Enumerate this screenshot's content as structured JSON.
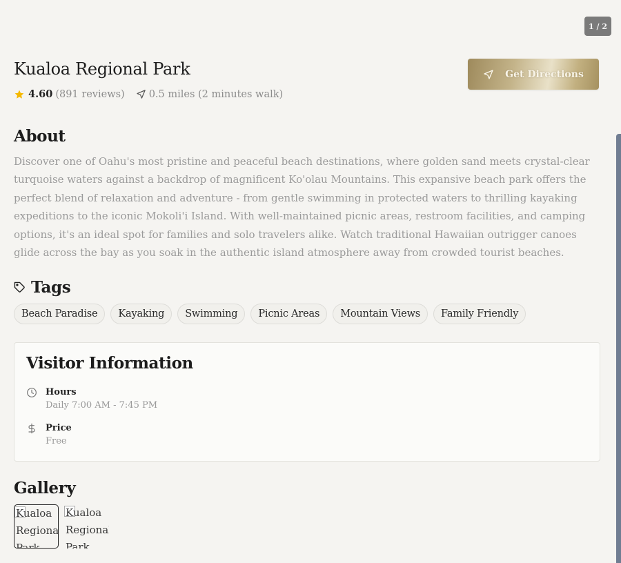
{
  "page_counter": "1 / 2",
  "place": {
    "name": "Kualoa Regional Park",
    "rating": "4.60",
    "reviews": "(891 reviews)",
    "distance": "0.5 miles (2 minutes walk)"
  },
  "actions": {
    "directions_label": "Get Directions"
  },
  "about": {
    "heading": "About",
    "text": "Discover one of Oahu's most pristine and peaceful beach destinations, where golden sand meets crystal-clear turquoise waters against a backdrop of magnificent Ko'olau Mountains. This expansive beach park offers the perfect blend of relaxation and adventure - from gentle swimming in protected waters to thrilling kayaking expeditions to the iconic Mokoli'i Island. With well-maintained picnic areas, restroom facilities, and camping options, it's an ideal spot for families and solo travelers alike. Watch traditional Hawaiian outrigger canoes glide across the bay as you soak in the authentic island atmosphere away from crowded tourist beaches."
  },
  "tags": {
    "heading": "Tags",
    "items": [
      "Beach Paradise",
      "Kayaking",
      "Swimming",
      "Picnic Areas",
      "Mountain Views",
      "Family Friendly"
    ]
  },
  "visitor_info": {
    "heading": "Visitor Information",
    "hours_label": "Hours",
    "hours_value": "Daily 7:00 AM - 7:45 PM",
    "price_label": "Price",
    "price_value": "Free"
  },
  "gallery": {
    "heading": "Gallery",
    "images": [
      {
        "alt": "Kualoa Regional Park"
      },
      {
        "alt": "Kualoa Regional Park"
      }
    ]
  },
  "colors": {
    "background": "#f5f4f1",
    "star": "#f5b800",
    "muted_text": "#9a9a9a",
    "button_gold": "#c4b48a",
    "scrollbar": "#707d92"
  },
  "icons": [
    "star-icon",
    "navigation-arrow-icon",
    "tag-icon",
    "clock-icon",
    "dollar-icon"
  ]
}
